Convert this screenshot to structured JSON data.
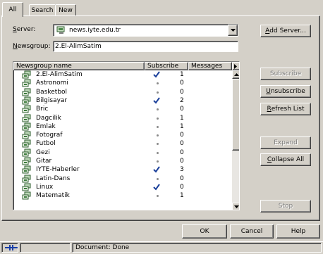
{
  "tabs": [
    "All",
    "Search",
    "New"
  ],
  "server": {
    "label": "Server:",
    "value": "news.iyte.edu.tr"
  },
  "newsgroup": {
    "label": "Newsgroup:",
    "value": "2.El-AlimSatim"
  },
  "buttons": {
    "add_server": "Add Server...",
    "subscribe": "Subscribe",
    "unsubscribe": "Unsubscribe",
    "refresh_list": "Refresh List",
    "expand": "Expand",
    "collapse_all": "Collapse All",
    "stop": "Stop",
    "ok": "OK",
    "cancel": "Cancel",
    "help": "Help"
  },
  "list": {
    "columns": [
      "Newsgroup name",
      "Subscribe",
      "Messages"
    ],
    "rows": [
      {
        "name": "2.El-AlimSatim",
        "subscribed": true,
        "messages": "1"
      },
      {
        "name": "Astronomi",
        "subscribed": false,
        "messages": "0"
      },
      {
        "name": "Basketbol",
        "subscribed": false,
        "messages": "0"
      },
      {
        "name": "Bilgisayar",
        "subscribed": true,
        "messages": "2"
      },
      {
        "name": "Bric",
        "subscribed": false,
        "messages": "0"
      },
      {
        "name": "Dagcilik",
        "subscribed": false,
        "messages": "1"
      },
      {
        "name": "Emlak",
        "subscribed": false,
        "messages": "1"
      },
      {
        "name": "Fotograf",
        "subscribed": false,
        "messages": "0"
      },
      {
        "name": "Futbol",
        "subscribed": false,
        "messages": "0"
      },
      {
        "name": "Gezi",
        "subscribed": false,
        "messages": "0"
      },
      {
        "name": "Gitar",
        "subscribed": false,
        "messages": "0"
      },
      {
        "name": "IYTE-Haberler",
        "subscribed": true,
        "messages": "3"
      },
      {
        "name": "Latin-Dans",
        "subscribed": false,
        "messages": "0"
      },
      {
        "name": "Linux",
        "subscribed": true,
        "messages": "0"
      },
      {
        "name": "Matematik",
        "subscribed": false,
        "messages": "1"
      }
    ]
  },
  "status": {
    "text": "Document: Done"
  },
  "icons": {
    "server": "news-server-icon",
    "newsgroup": "newsgroup-icon",
    "subscribed": "checkmark-icon",
    "status": "connection-icon"
  },
  "colors": {
    "background": "#d4d0c8",
    "field": "#ffffff",
    "disabled": "#808080",
    "checkmark": "#1a3f9a"
  }
}
